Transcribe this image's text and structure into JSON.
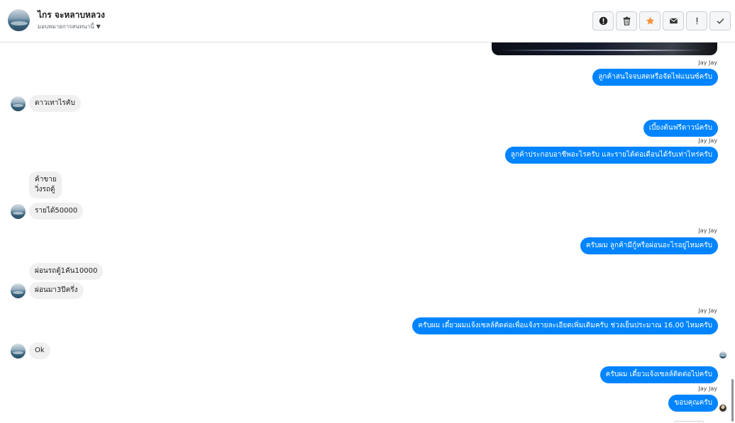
{
  "header": {
    "name": "ไกร จะหลาบหลวง",
    "subtitle": "มอบหมายการสนทนานี้",
    "toolbar": [
      {
        "name": "alert-button",
        "icon": "alert-circle-icon"
      },
      {
        "name": "delete-button",
        "icon": "trash-icon"
      },
      {
        "name": "star-button",
        "icon": "star-icon"
      },
      {
        "name": "mail-button",
        "icon": "envelope-icon"
      },
      {
        "name": "important-button",
        "icon": "exclamation-icon"
      },
      {
        "name": "done-button",
        "icon": "checkmark-icon"
      }
    ],
    "star_color": "#f7923a"
  },
  "messages": {
    "m0_sender": "Jay Jay",
    "m0_text": "ลูกค้าสนใจจบสดหรือจัดไฟแนนซ์ครับ",
    "m1_text": "ดาวเทาไรคับ",
    "m2_text": "เบี้ยงต้นฟรีดาวน์ครับ",
    "m3_sender": "Jay Jay",
    "m3_text": "ลูกค้าประกอบอาชีพอะไรครับ และรายได้ต่อเดือนได้รับเท่าไหร่ครับ",
    "m4_text": "ค้าขาย\nวิ่งรถตู้",
    "m5_text": "รายได้50000",
    "m6_sender": "Jay Jay",
    "m6_text": "ครับผม ลูกค้ามีกู้หรือผ่อนอะไรอยู่ไหมครับ",
    "m7_text": "ผ่อนรถตู้1คัน10000",
    "m8_text": "ผ่อนมา3ปีครึ่ง",
    "m9_sender": "Jay Jay",
    "m9_text": "ครับผม เดี๋ยวผมแจ้งเซลล์ติดต่อเพื่อแจ้งรายละเอียดเพิ่มเติมครับ ช่วงเย็นประมาณ 16.00 ไหมครับ",
    "m10_text": "Ok",
    "m11_text": "ครับผม เดี๋ยวแจ้งเซลล์ติดต่อไปครับ",
    "m12_sender": "Jay Jay",
    "m12_text": "ขอบคุณครับ"
  },
  "colors": {
    "outgoing_bubble": "#0084ff",
    "incoming_bubble": "#f1f0f0"
  }
}
